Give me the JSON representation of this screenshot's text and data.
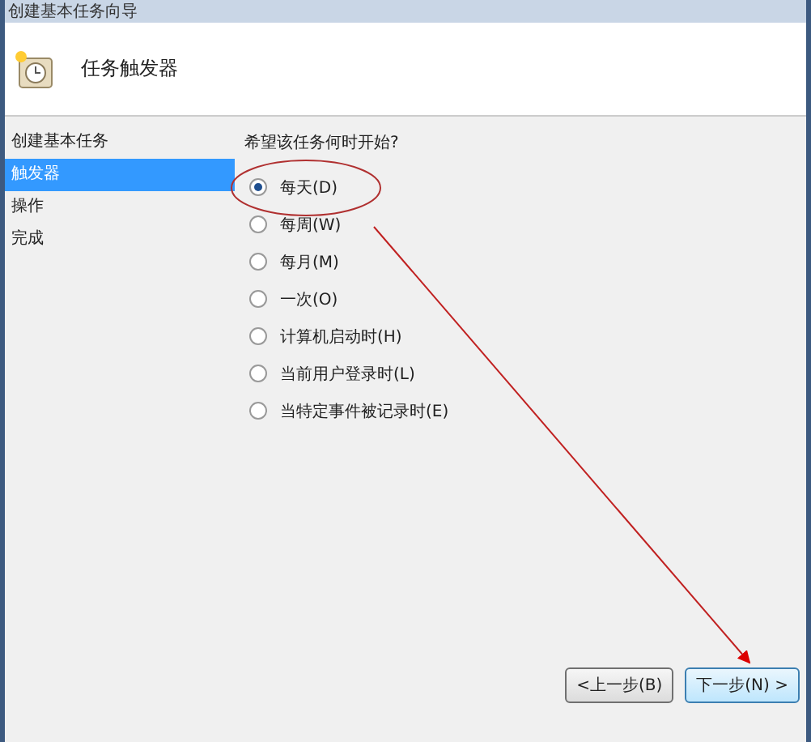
{
  "window": {
    "title": "创建基本任务向导"
  },
  "header": {
    "title": "任务触发器"
  },
  "sidebar": {
    "items": [
      {
        "label": "创建基本任务",
        "selected": false
      },
      {
        "label": "触发器",
        "selected": true
      },
      {
        "label": "操作",
        "selected": false
      },
      {
        "label": "完成",
        "selected": false
      }
    ]
  },
  "question": "希望该任务何时开始?",
  "options": [
    {
      "label": "每天(D)",
      "selected": true
    },
    {
      "label": "每周(W)",
      "selected": false
    },
    {
      "label": "每月(M)",
      "selected": false
    },
    {
      "label": "一次(O)",
      "selected": false
    },
    {
      "label": "计算机启动时(H)",
      "selected": false
    },
    {
      "label": "当前用户登录时(L)",
      "selected": false
    },
    {
      "label": "当特定事件被记录时(E)",
      "selected": false
    }
  ],
  "buttons": [
    {
      "label": "<上一步(B)",
      "kind": "normal"
    },
    {
      "label": "下一步(N) >",
      "kind": "default"
    }
  ]
}
